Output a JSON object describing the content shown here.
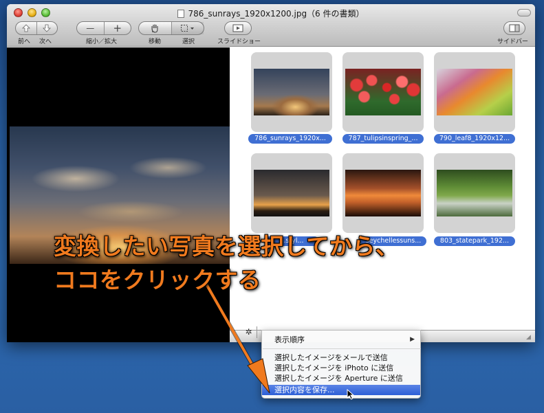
{
  "window": {
    "title": "786_sunrays_1920x1200.jpg（6 件の書類）"
  },
  "toolbar": {
    "back_label": "前へ",
    "next_label": "次へ",
    "zoom_label": "縮小／拡大",
    "zoom_out_glyph": "—",
    "zoom_in_glyph": "+",
    "move_label": "移動",
    "select_label": "選択",
    "slideshow_label": "スライドショー",
    "sidebar_label": "サイドバー"
  },
  "thumbnails": [
    {
      "label": "786_sunrays_1920x...",
      "image": "sunrays"
    },
    {
      "label": "787_tulipsinspring_...",
      "image": "tulips"
    },
    {
      "label": "790_leaf8_1920x12...",
      "image": "leaf"
    },
    {
      "label": "...styl...",
      "image": "tree"
    },
    {
      "label": "seychellessuns...",
      "image": "seychelles"
    },
    {
      "label": "803_statepark_192...",
      "image": "park"
    }
  ],
  "status": {
    "gear_glyph": "✲"
  },
  "menu": {
    "items": [
      {
        "label": "表示順序",
        "has_submenu": true,
        "highlighted": false
      },
      {
        "label": "選択したイメージをメールで送信",
        "highlighted": false
      },
      {
        "label": "選択したイメージを iPhoto に送信",
        "highlighted": false
      },
      {
        "label": "選択したイメージを Aperture に送信",
        "highlighted": false
      },
      {
        "label": "選択内容を保存...",
        "highlighted": true
      }
    ]
  },
  "annotation": {
    "line1": "変換したい写真を選択してから、",
    "line2": "ココをクリックする",
    "color": "#f07a1e"
  },
  "colors": {
    "selection_label": "#3f6fd3",
    "menu_highlight": "#2d5fd6",
    "desktop": "#2c69b0"
  }
}
